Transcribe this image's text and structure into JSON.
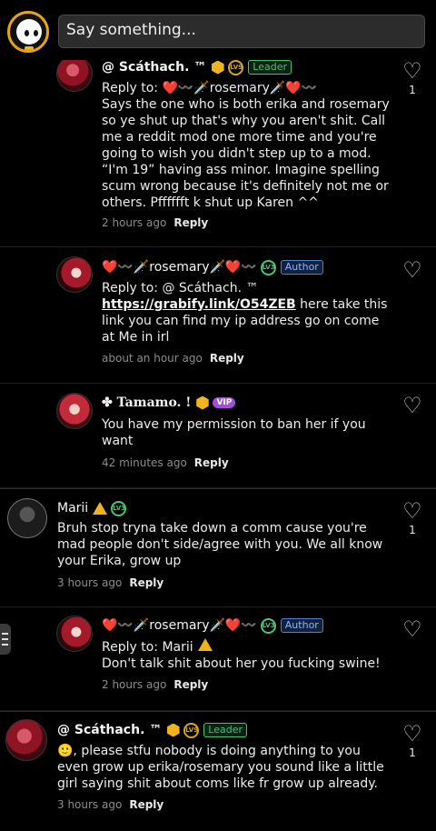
{
  "composer": {
    "placeholder": "Say something..."
  },
  "comments": [
    {
      "author": "@ Scáthach. ™",
      "leader": "Leader",
      "reply_to": "Reply to: ❤️〰️🗡️rosemary🗡️❤️〰️",
      "text": "Says the one who is both erika and rosemary so ye shut up that's why you aren't shit. Call me a reddit mod one more time and you're going to wish you didn't step up to a mod. “I'm 19” having ass minor. Imagine spelling scum wrong because it's definitely not me or others. Pfffffft k shut up Karen ^^",
      "time": "2 hours ago",
      "reply_label": "Reply",
      "likes": "1"
    },
    {
      "author": "❤️〰️🗡️rosemary🗡️❤️〰️",
      "author_tag": "Author",
      "reply_to": "Reply to: @ Scáthach. ™",
      "link": "https://grabify.link/O54ZEB",
      "text": " here take this link you can find my ip address go on come at Me in irl",
      "time": "about an hour ago",
      "reply_label": "Reply"
    },
    {
      "author": "✤ Tamamo. !",
      "vip": "VIP",
      "text": "You have my permission to ban her if you want",
      "time": "42 minutes ago",
      "reply_label": "Reply"
    },
    {
      "author": "Marii",
      "text": "Bruh stop tryna take down a comm cause you're mad people don't side/agree with you. We all know your Erika, grow up",
      "time": "3 hours ago",
      "reply_label": "Reply",
      "likes": "1"
    },
    {
      "author": "❤️〰️🗡️rosemary🗡️❤️〰️",
      "author_tag": "Author",
      "reply_to": "Reply to: Marii",
      "text": "Don't talk shit about her you fucking swine!",
      "time": "2 hours ago",
      "reply_label": "Reply"
    },
    {
      "author": "@ Scáthach. ™",
      "leader": "Leader",
      "text": "🙂, please stfu nobody is doing anything to you even grow up erika/rosemary you sound like a little girl saying shit about coms like fr grow up already.",
      "time": "3 hours ago",
      "reply_label": "Reply",
      "likes": "1"
    }
  ],
  "colors": {
    "background": "#000000",
    "leader": "#42c46e",
    "author": "#4d7fd6",
    "heart": "#e21d3a",
    "vip": "#a34ed8"
  },
  "icons": [
    "profile-avatar-icon",
    "heart-outline-icon",
    "warning-icon",
    "level-badge-icon",
    "menu-handle-icon"
  ]
}
